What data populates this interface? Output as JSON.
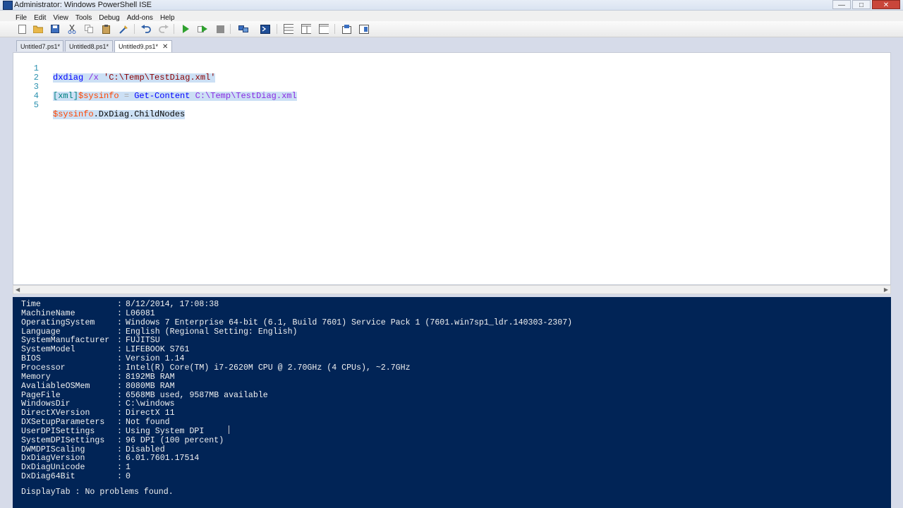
{
  "window": {
    "title": "Administrator: Windows PowerShell ISE"
  },
  "menu": [
    "File",
    "Edit",
    "View",
    "Tools",
    "Debug",
    "Add-ons",
    "Help"
  ],
  "toolbar_icons": [
    "new-icon",
    "open-icon",
    "save-icon",
    "cut-icon",
    "copy-icon",
    "paste-icon",
    "clear-icon",
    "undo-icon",
    "redo-icon",
    "run-icon",
    "run-selection-icon",
    "stop-icon",
    "remote-icon",
    "console-icon",
    "pane-top-icon",
    "pane-right-icon",
    "pane-max-icon",
    "snippets-icon",
    "commands-icon"
  ],
  "tabs": [
    {
      "label": "Untitled7.ps1*"
    },
    {
      "label": "Untitled8.ps1*"
    },
    {
      "label": "Untitled9.ps1*",
      "active": true
    }
  ],
  "editor": {
    "lines": [
      {
        "num": "1",
        "tokens": [
          {
            "t": "dxdiag",
            "c": "cmd"
          },
          {
            "t": " /x ",
            "c": "arg"
          },
          {
            "t": "'C:\\Temp\\TestDiag.xml'",
            "c": "str"
          }
        ]
      },
      {
        "num": "2",
        "tokens": []
      },
      {
        "num": "3",
        "tokens": [
          {
            "t": "[xml]",
            "c": "type"
          },
          {
            "t": "$sysinfo",
            "c": "var"
          },
          {
            "t": " = ",
            "c": "op"
          },
          {
            "t": "Get-Content",
            "c": "cmd"
          },
          {
            "t": " C:\\Temp\\TestDiag.xml",
            "c": "arg"
          }
        ]
      },
      {
        "num": "4",
        "tokens": []
      },
      {
        "num": "5",
        "tokens": [
          {
            "t": "$sysinfo",
            "c": "var"
          },
          {
            "t": ".DxDiag.ChildNodes",
            "c": "plain"
          }
        ]
      }
    ]
  },
  "console": {
    "rows": [
      {
        "key": "Time",
        "value": "8/12/2014, 17:08:38"
      },
      {
        "key": "MachineName",
        "value": "L06081"
      },
      {
        "key": "OperatingSystem",
        "value": "Windows 7 Enterprise 64-bit (6.1, Build 7601) Service Pack 1 (7601.win7sp1_ldr.140303-2307)"
      },
      {
        "key": "Language",
        "value": "English (Regional Setting: English)"
      },
      {
        "key": "SystemManufacturer",
        "value": "FUJITSU"
      },
      {
        "key": "SystemModel",
        "value": "LIFEBOOK S761"
      },
      {
        "key": "BIOS",
        "value": "Version 1.14"
      },
      {
        "key": "Processor",
        "value": "Intel(R) Core(TM) i7-2620M CPU @ 2.70GHz (4 CPUs), ~2.7GHz"
      },
      {
        "key": "Memory",
        "value": "8192MB RAM"
      },
      {
        "key": "AvaliableOSMem",
        "value": "8080MB RAM"
      },
      {
        "key": "PageFile",
        "value": "6568MB used, 9587MB available"
      },
      {
        "key": "WindowsDir",
        "value": "C:\\windows"
      },
      {
        "key": "DirectXVersion",
        "value": "DirectX 11"
      },
      {
        "key": "DXSetupParameters",
        "value": "Not found"
      },
      {
        "key": "UserDPISettings",
        "value": "Using System DPI"
      },
      {
        "key": "SystemDPISettings",
        "value": "96 DPI (100 percent)"
      },
      {
        "key": "DWMDPIScaling",
        "value": "Disabled"
      },
      {
        "key": "DxDiagVersion",
        "value": "6.01.7601.17514"
      },
      {
        "key": "DxDiagUnicode",
        "value": "1"
      },
      {
        "key": "DxDiag64Bit",
        "value": "0"
      }
    ],
    "footer": "DisplayTab : No problems found."
  },
  "colors": {
    "console_bg": "#012456",
    "editor_selection": "#cce0f5",
    "line_number": "#2b91af"
  }
}
